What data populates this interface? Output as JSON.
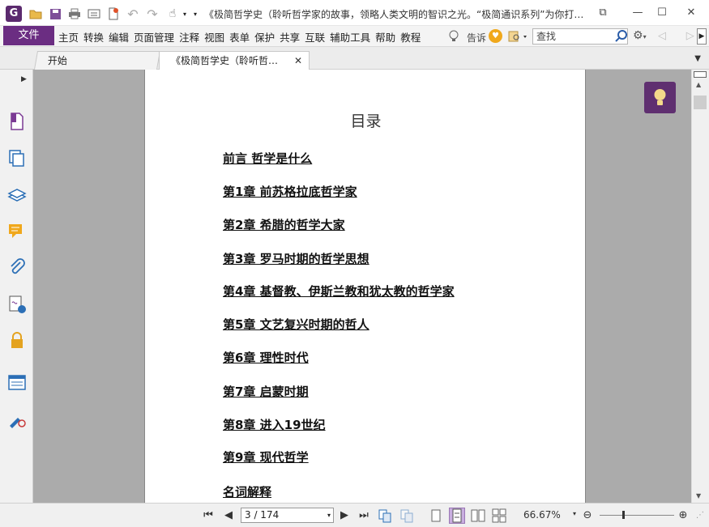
{
  "window": {
    "app_logo_letter": "G",
    "title": "《极简哲学史（聆听哲学家的故事，领略人类文明的智识之光。“极简通识系列”为你打…",
    "controls": [
      "⧉",
      "—",
      "☐",
      "✕"
    ]
  },
  "menu": {
    "file": "文件",
    "items": [
      "主页",
      "转换",
      "编辑",
      "页面管理",
      "注释",
      "视图",
      "表单",
      "保护",
      "共享",
      "互联",
      "辅助工具",
      "帮助",
      "教程"
    ],
    "tell_me": "告诉",
    "search_placeholder": "查找"
  },
  "tabs": {
    "start": "开始",
    "active": "《极简哲学史（聆听哲…",
    "close": "✕"
  },
  "document": {
    "toc_title": "目录",
    "toc_items": [
      "前言 哲学是什么",
      "第1章 前苏格拉底哲学家",
      "第2章 希腊的哲学大家",
      "第3章 罗马时期的哲学思想",
      "第4章 基督教、伊斯兰教和犹太教的哲学家",
      "第5章 文艺复兴时期的哲人",
      "第6章 理性时代",
      "第7章 启蒙时期",
      "第8章 进入19世纪",
      "第9章 现代哲学",
      "名词解释"
    ]
  },
  "statusbar": {
    "page_display": "3 / 174",
    "zoom": "66.67%"
  },
  "colors": {
    "brand_purple": "#6b2d82",
    "doc_background": "#ababab",
    "heart_orange": "#f0a81c"
  }
}
